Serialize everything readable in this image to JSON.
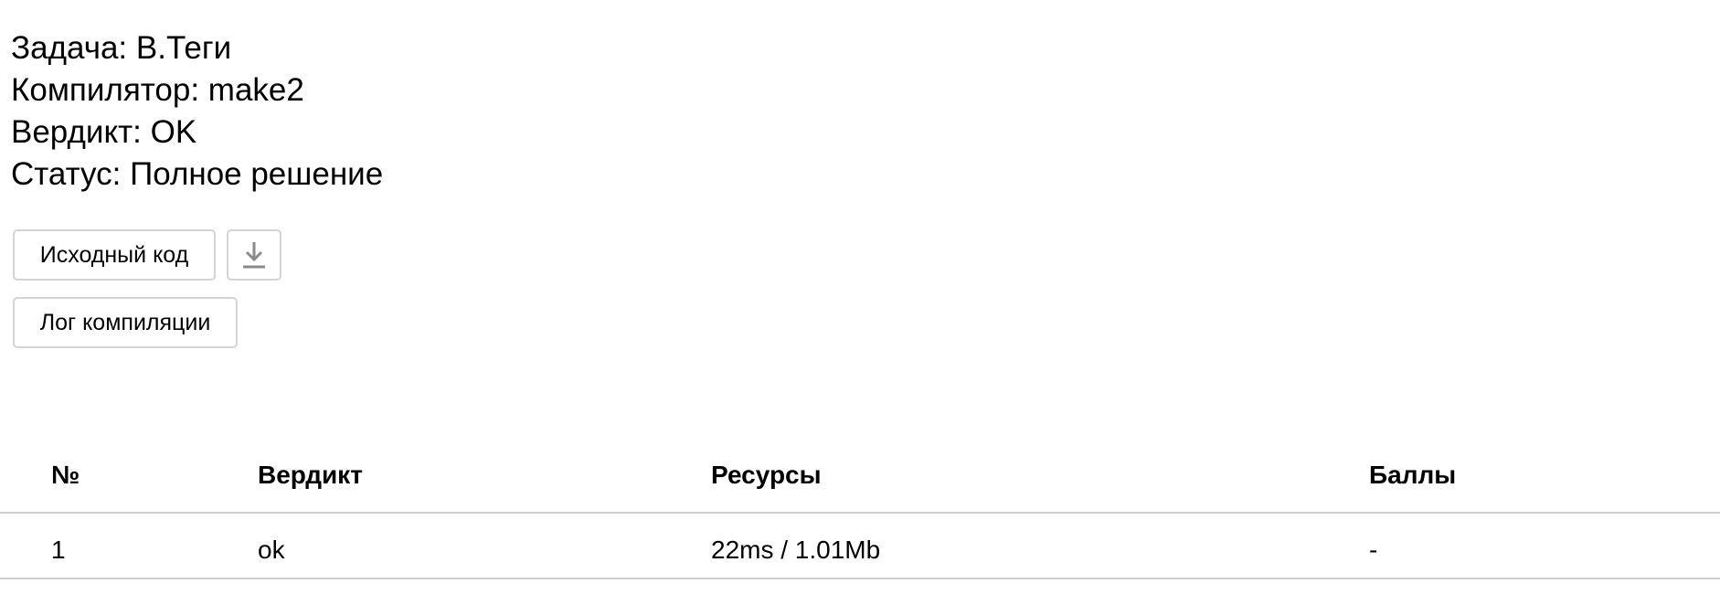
{
  "submission": {
    "task": "Задача: B.Теги",
    "compiler": "Компилятор: make2",
    "verdict": "Вердикт: OK",
    "status": "Статус: Полное решение"
  },
  "actions": {
    "source_code_label": "Исходный код",
    "download_icon": "download-icon",
    "compile_log_label": "Лог компиляции"
  },
  "tests_table": {
    "headers": [
      "№",
      "Вердикт",
      "Ресурсы",
      "Баллы"
    ],
    "rows": [
      [
        "1",
        "ok",
        "22ms / 1.01Mb",
        "-"
      ]
    ]
  },
  "colors": {
    "border": "#d4d4d4",
    "divider": "#d0d0d0",
    "icon": "#8a8a8a"
  }
}
